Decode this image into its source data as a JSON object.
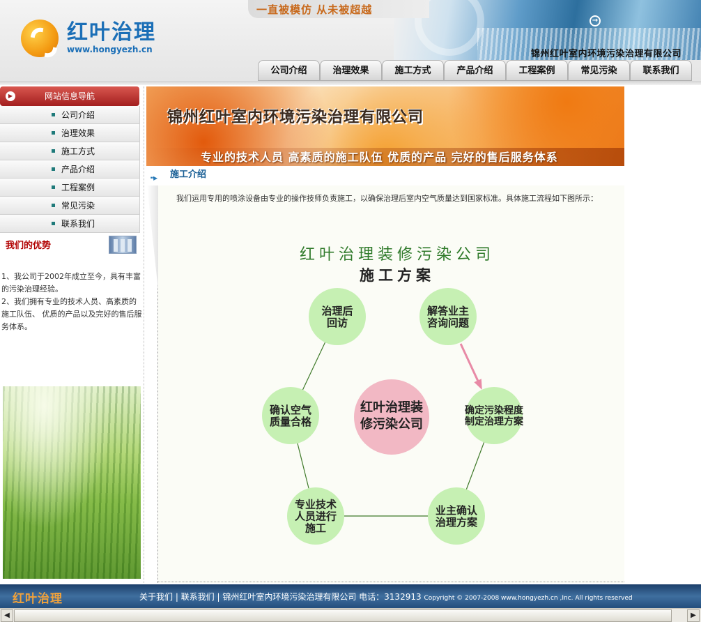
{
  "header": {
    "logo_name": "红叶治理",
    "logo_url": "www.hongyezh.cn",
    "slogan": "一直被模仿  从未被超越",
    "company": "锦州红叶室内环境污染治理有限公司"
  },
  "topnav": [
    "公司介绍",
    "治理效果",
    "施工方式",
    "产品介绍",
    "工程案例",
    "常见污染",
    "联系我们"
  ],
  "sidebar": {
    "nav_title": "网站信息导航",
    "items": [
      "公司介绍",
      "治理效果",
      "施工方式",
      "产品介绍",
      "工程案例",
      "常见污染",
      "联系我们"
    ],
    "adv_title": "我们的优势",
    "adv_lines": [
      "1、我公司于2002年成立至今，具有丰富的污染治理经验。",
      "2、我们拥有专业的技术人员、高素质的施工队伍、 优质的产品以及完好的售后服务体系。"
    ]
  },
  "banner": {
    "title": "锦州红叶室内环境污染治理有限公司",
    "tagline": "专业的技术人员   高素质的施工队伍   优质的产品   完好的售后服务体系"
  },
  "section": {
    "title": "施工介绍",
    "intro": "我们运用专用的喷涂设备由专业的操作技师负责施工，以确保治理后室内空气质量达到国家标准。具体施工流程如下图所示："
  },
  "diagram": {
    "title_line1": "红叶治理装修污染公司",
    "title_line2": "施工方案",
    "center": [
      "红叶治理装",
      "修污染公司"
    ],
    "nodes": [
      [
        "解答业主",
        "咨询问题"
      ],
      [
        "确定污染程度",
        "制定治理方案"
      ],
      [
        "业主确认",
        "治理方案"
      ],
      [
        "专业技术",
        "人员进行",
        "施工"
      ],
      [
        "确认空气",
        "质量合格"
      ],
      [
        "治理后",
        "回访"
      ]
    ],
    "colors": {
      "node": "#c6f0b3",
      "center": "#f2b8c4",
      "title": "#2f7a2a",
      "arrow": "#e88aa6",
      "edge": "#3f7a2a"
    }
  },
  "footer": {
    "brand": "红叶治理",
    "links": "关于我们 | 联系我们 | 锦州红叶室内环境污染治理有限公司 电话：3132913",
    "copyright": "Copyright © 2007-2008 www.hongyezh.cn ,Inc. All rights reserved"
  }
}
